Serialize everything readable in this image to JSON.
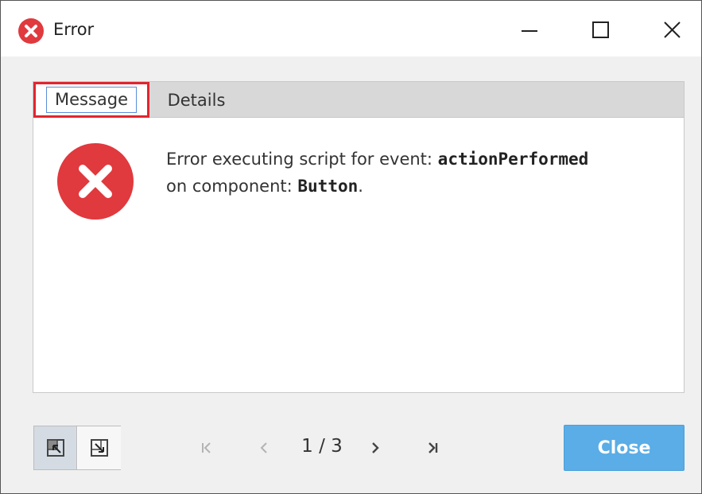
{
  "window": {
    "title": "Error",
    "title_icon": "error-circle-icon",
    "controls": {
      "minimize": "minimize-icon",
      "maximize": "maximize-icon",
      "close": "close-icon"
    }
  },
  "tabs": [
    {
      "label": "Message",
      "selected": true
    },
    {
      "label": "Details",
      "selected": false
    }
  ],
  "message": {
    "icon": "error-x-icon",
    "line1_prefix": "Error executing script for event: ",
    "event_name": "actionPerformed",
    "line2_prefix": "on component: ",
    "component_name": "Button",
    "line2_suffix": "."
  },
  "footer": {
    "view_toggles": [
      "collapse-view-icon",
      "expand-view-icon"
    ],
    "pager": {
      "first_icon": "first-page-icon",
      "prev_icon": "previous-page-icon",
      "page_text": "1 / 3",
      "next_icon": "next-page-icon",
      "last_icon": "last-page-icon"
    },
    "close_label": "Close"
  },
  "colors": {
    "error_red": "#e0393e",
    "highlight_red": "#e2252e",
    "close_button_blue": "#5aade6",
    "tab_bar_gray": "#d8d8d8",
    "window_bg": "#f0f0f0"
  }
}
